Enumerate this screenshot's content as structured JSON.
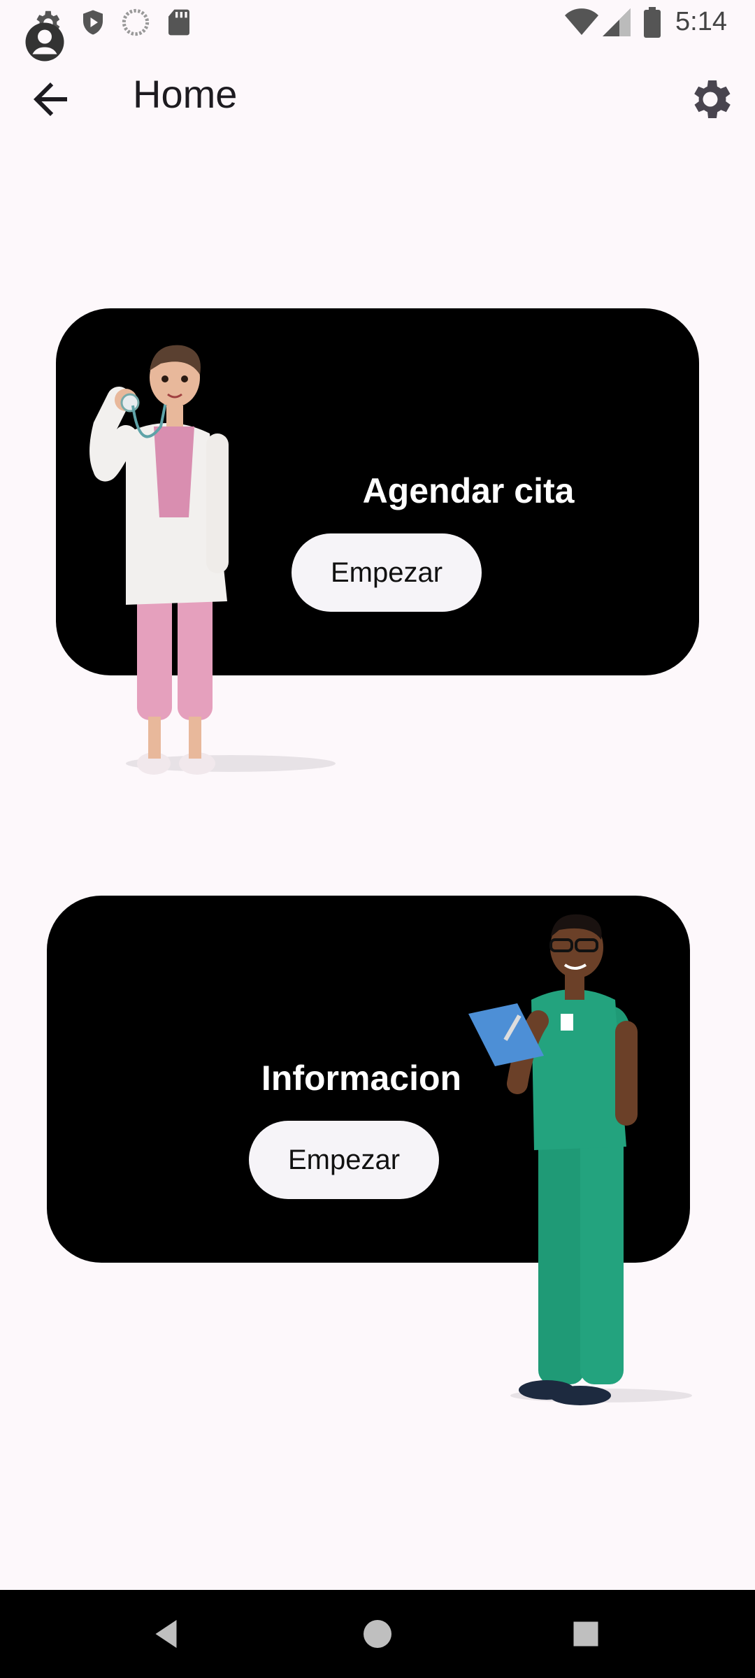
{
  "status_bar": {
    "time": "5:14",
    "icons": [
      "settings-notification-icon",
      "shield-icon",
      "sync-icon",
      "sd-card-icon",
      "account-icon",
      "wifi-icon",
      "signal-icon",
      "battery-icon"
    ]
  },
  "app_bar": {
    "title": "Home",
    "back_icon": "arrow-back-icon",
    "settings_icon": "gear-icon"
  },
  "cards": [
    {
      "title": "Agendar cita",
      "button_label": "Empezar",
      "illustration": "doctor-female-figure"
    },
    {
      "title": "Informacion",
      "button_label": "Empezar",
      "illustration": "nurse-male-figure"
    }
  ],
  "nav_bar": {
    "icons": [
      "back-triangle-icon",
      "home-circle-icon",
      "recents-square-icon"
    ]
  },
  "colors": {
    "background": "#fdf8fb",
    "card": "#000000",
    "button": "#f6f4f8",
    "scrub_green": "#23a37e",
    "pants_pink": "#e5a0bd"
  }
}
